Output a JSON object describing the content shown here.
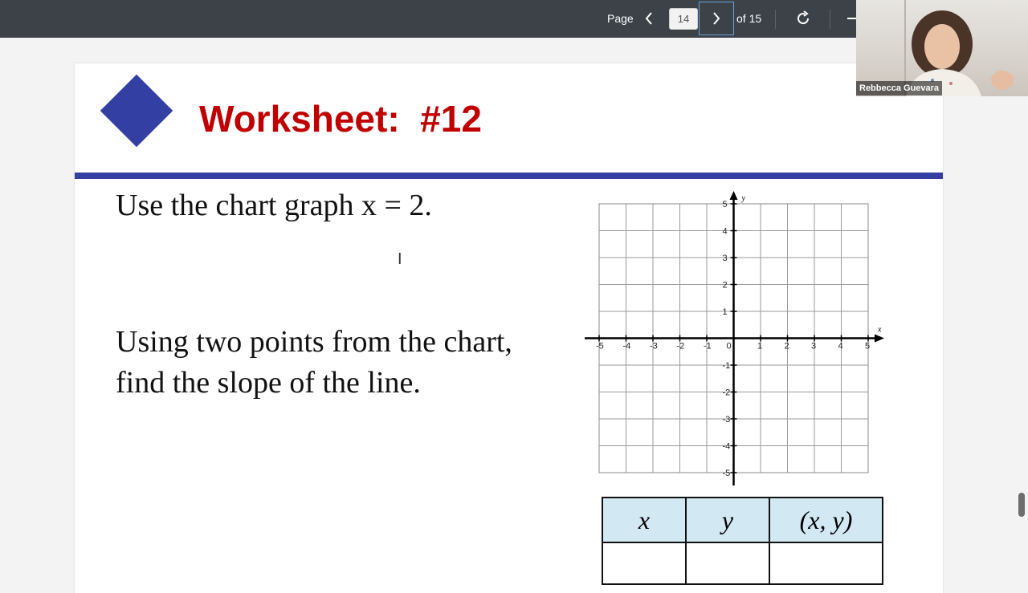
{
  "toolbar": {
    "page_label": "Page",
    "page_number": "14",
    "of_label": "of 15",
    "prev_icon": "chevron-left-icon",
    "next_icon": "chevron-right-icon",
    "rotate_icon": "rotate-icon"
  },
  "video": {
    "participant_name": "Rebbecca Guevara"
  },
  "slide": {
    "title": "Worksheet:  #12",
    "question1": "Use the chart graph x = 2.",
    "question2": "Using two points from the chart, find the slope of the line.",
    "title_color": "#c00000",
    "accent_color": "#343fa4"
  },
  "graph": {
    "x_axis_label": "x",
    "y_axis_label": "y",
    "origin_label": "0",
    "x_ticks": [
      "-5",
      "-4",
      "-3",
      "-2",
      "-1",
      "1",
      "2",
      "3",
      "4",
      "5"
    ],
    "y_ticks": [
      "5",
      "4",
      "3",
      "2",
      "1",
      "-1",
      "-2",
      "-3",
      "-4",
      "-5"
    ]
  },
  "table": {
    "headers": [
      "x",
      "y",
      "(x, y)"
    ]
  }
}
